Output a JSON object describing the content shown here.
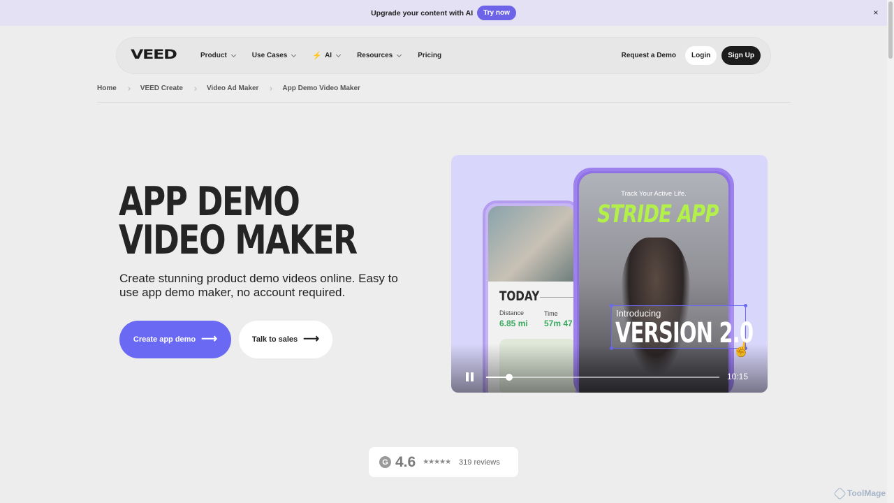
{
  "banner": {
    "text": "Upgrade your content with AI",
    "cta": "Try now",
    "close": "×"
  },
  "nav": {
    "logo": "VEED",
    "items": [
      {
        "label": "Product",
        "dropdown": true
      },
      {
        "label": "Use Cases",
        "dropdown": true
      },
      {
        "label": "AI",
        "dropdown": true,
        "icon": "bolt-icon"
      },
      {
        "label": "Resources",
        "dropdown": true
      },
      {
        "label": "Pricing",
        "dropdown": false
      }
    ],
    "request_demo": "Request a Demo",
    "login": "Login",
    "signup": "Sign Up"
  },
  "breadcrumb": [
    "Home",
    "VEED Create",
    "Video Ad Maker",
    "App Demo Video Maker"
  ],
  "hero": {
    "title": "APP DEMO VIDEO MAKER",
    "subtitle": "Create stunning product demo videos online. Easy to use app demo maker, no account required.",
    "primary_cta": "Create app demo",
    "secondary_cta": "Talk to sales"
  },
  "video": {
    "today": "TODAY",
    "distance_label": "Distance",
    "distance_value": "6.85 mi",
    "time_label": "Time",
    "time_value": "57m 47",
    "tagline": "Track Your Active Life.",
    "app_name": "STRIDE APP",
    "intro": "Introducing",
    "version": "VERSION 2.0",
    "timestamp": "10:15",
    "progress": 0.1
  },
  "rating": {
    "score": "4.6",
    "stars": "★★★★★",
    "reviews": "319 reviews",
    "badge": "G"
  },
  "watermark": "ToolMage",
  "colors": {
    "accent": "#6a69f3",
    "banner": "#e4e1f5",
    "app_green": "#b3f04a"
  }
}
